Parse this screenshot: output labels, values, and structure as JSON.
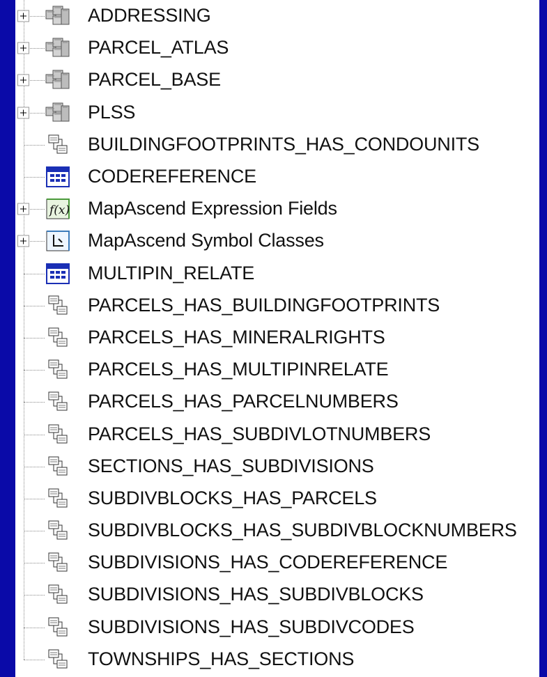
{
  "tree": {
    "items": [
      {
        "label": "ADDRESSING",
        "icon": "feature-dataset-icon",
        "expandable": true
      },
      {
        "label": "PARCEL_ATLAS",
        "icon": "feature-dataset-icon",
        "expandable": true
      },
      {
        "label": "PARCEL_BASE",
        "icon": "feature-dataset-icon",
        "expandable": true
      },
      {
        "label": "PLSS",
        "icon": "feature-dataset-icon",
        "expandable": true
      },
      {
        "label": "BUILDINGFOOTPRINTS_HAS_CONDOUNITS",
        "icon": "relationship-class-icon",
        "expandable": false
      },
      {
        "label": "CODEREFERENCE",
        "icon": "table-icon",
        "expandable": false
      },
      {
        "label": "MapAscend Expression Fields",
        "icon": "expression-fields-icon",
        "expandable": true
      },
      {
        "label": "MapAscend Symbol Classes",
        "icon": "symbol-classes-icon",
        "expandable": true
      },
      {
        "label": "MULTIPIN_RELATE",
        "icon": "table-icon",
        "expandable": false
      },
      {
        "label": "PARCELS_HAS_BUILDINGFOOTPRINTS",
        "icon": "relationship-class-icon",
        "expandable": false
      },
      {
        "label": "PARCELS_HAS_MINERALRIGHTS",
        "icon": "relationship-class-icon",
        "expandable": false
      },
      {
        "label": "PARCELS_HAS_MULTIPINRELATE",
        "icon": "relationship-class-icon",
        "expandable": false
      },
      {
        "label": "PARCELS_HAS_PARCELNUMBERS",
        "icon": "relationship-class-icon",
        "expandable": false
      },
      {
        "label": "PARCELS_HAS_SUBDIVLOTNUMBERS",
        "icon": "relationship-class-icon",
        "expandable": false
      },
      {
        "label": "SECTIONS_HAS_SUBDIVISIONS",
        "icon": "relationship-class-icon",
        "expandable": false
      },
      {
        "label": "SUBDIVBLOCKS_HAS_PARCELS",
        "icon": "relationship-class-icon",
        "expandable": false
      },
      {
        "label": "SUBDIVBLOCKS_HAS_SUBDIVBLOCKNUMBERS",
        "icon": "relationship-class-icon",
        "expandable": false
      },
      {
        "label": "SUBDIVISIONS_HAS_CODEREFERENCE",
        "icon": "relationship-class-icon",
        "expandable": false
      },
      {
        "label": "SUBDIVISIONS_HAS_SUBDIVBLOCKS",
        "icon": "relationship-class-icon",
        "expandable": false
      },
      {
        "label": "SUBDIVISIONS_HAS_SUBDIVCODES",
        "icon": "relationship-class-icon",
        "expandable": false
      },
      {
        "label": "TOWNSHIPS_HAS_SECTIONS",
        "icon": "relationship-class-icon",
        "expandable": false
      }
    ]
  },
  "colors": {
    "background": "#0a0aa8",
    "panel": "#ffffff",
    "text": "#111111",
    "tree_line": "#8a8a8a"
  }
}
